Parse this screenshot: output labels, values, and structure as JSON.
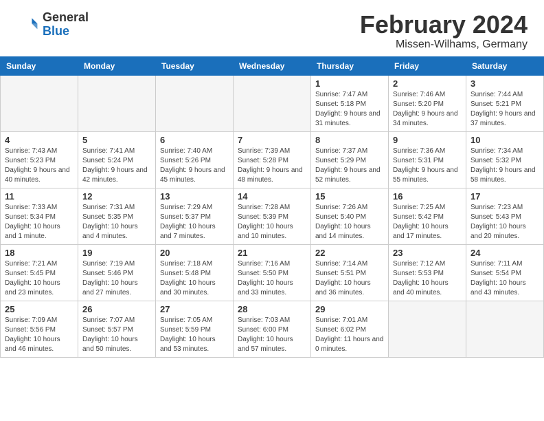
{
  "header": {
    "logo": {
      "general": "General",
      "blue": "Blue"
    },
    "title": "February 2024",
    "subtitle": "Missen-Wilhams, Germany"
  },
  "weekdays": [
    "Sunday",
    "Monday",
    "Tuesday",
    "Wednesday",
    "Thursday",
    "Friday",
    "Saturday"
  ],
  "weeks": [
    [
      {
        "day": "",
        "empty": true
      },
      {
        "day": "",
        "empty": true
      },
      {
        "day": "",
        "empty": true
      },
      {
        "day": "",
        "empty": true
      },
      {
        "day": "1",
        "sunrise": "7:47 AM",
        "sunset": "5:18 PM",
        "daylight": "9 hours and 31 minutes."
      },
      {
        "day": "2",
        "sunrise": "7:46 AM",
        "sunset": "5:20 PM",
        "daylight": "9 hours and 34 minutes."
      },
      {
        "day": "3",
        "sunrise": "7:44 AM",
        "sunset": "5:21 PM",
        "daylight": "9 hours and 37 minutes."
      }
    ],
    [
      {
        "day": "4",
        "sunrise": "7:43 AM",
        "sunset": "5:23 PM",
        "daylight": "9 hours and 40 minutes."
      },
      {
        "day": "5",
        "sunrise": "7:41 AM",
        "sunset": "5:24 PM",
        "daylight": "9 hours and 42 minutes."
      },
      {
        "day": "6",
        "sunrise": "7:40 AM",
        "sunset": "5:26 PM",
        "daylight": "9 hours and 45 minutes."
      },
      {
        "day": "7",
        "sunrise": "7:39 AM",
        "sunset": "5:28 PM",
        "daylight": "9 hours and 48 minutes."
      },
      {
        "day": "8",
        "sunrise": "7:37 AM",
        "sunset": "5:29 PM",
        "daylight": "9 hours and 52 minutes."
      },
      {
        "day": "9",
        "sunrise": "7:36 AM",
        "sunset": "5:31 PM",
        "daylight": "9 hours and 55 minutes."
      },
      {
        "day": "10",
        "sunrise": "7:34 AM",
        "sunset": "5:32 PM",
        "daylight": "9 hours and 58 minutes."
      }
    ],
    [
      {
        "day": "11",
        "sunrise": "7:33 AM",
        "sunset": "5:34 PM",
        "daylight": "10 hours and 1 minute."
      },
      {
        "day": "12",
        "sunrise": "7:31 AM",
        "sunset": "5:35 PM",
        "daylight": "10 hours and 4 minutes."
      },
      {
        "day": "13",
        "sunrise": "7:29 AM",
        "sunset": "5:37 PM",
        "daylight": "10 hours and 7 minutes."
      },
      {
        "day": "14",
        "sunrise": "7:28 AM",
        "sunset": "5:39 PM",
        "daylight": "10 hours and 10 minutes."
      },
      {
        "day": "15",
        "sunrise": "7:26 AM",
        "sunset": "5:40 PM",
        "daylight": "10 hours and 14 minutes."
      },
      {
        "day": "16",
        "sunrise": "7:25 AM",
        "sunset": "5:42 PM",
        "daylight": "10 hours and 17 minutes."
      },
      {
        "day": "17",
        "sunrise": "7:23 AM",
        "sunset": "5:43 PM",
        "daylight": "10 hours and 20 minutes."
      }
    ],
    [
      {
        "day": "18",
        "sunrise": "7:21 AM",
        "sunset": "5:45 PM",
        "daylight": "10 hours and 23 minutes."
      },
      {
        "day": "19",
        "sunrise": "7:19 AM",
        "sunset": "5:46 PM",
        "daylight": "10 hours and 27 minutes."
      },
      {
        "day": "20",
        "sunrise": "7:18 AM",
        "sunset": "5:48 PM",
        "daylight": "10 hours and 30 minutes."
      },
      {
        "day": "21",
        "sunrise": "7:16 AM",
        "sunset": "5:50 PM",
        "daylight": "10 hours and 33 minutes."
      },
      {
        "day": "22",
        "sunrise": "7:14 AM",
        "sunset": "5:51 PM",
        "daylight": "10 hours and 36 minutes."
      },
      {
        "day": "23",
        "sunrise": "7:12 AM",
        "sunset": "5:53 PM",
        "daylight": "10 hours and 40 minutes."
      },
      {
        "day": "24",
        "sunrise": "7:11 AM",
        "sunset": "5:54 PM",
        "daylight": "10 hours and 43 minutes."
      }
    ],
    [
      {
        "day": "25",
        "sunrise": "7:09 AM",
        "sunset": "5:56 PM",
        "daylight": "10 hours and 46 minutes."
      },
      {
        "day": "26",
        "sunrise": "7:07 AM",
        "sunset": "5:57 PM",
        "daylight": "10 hours and 50 minutes."
      },
      {
        "day": "27",
        "sunrise": "7:05 AM",
        "sunset": "5:59 PM",
        "daylight": "10 hours and 53 minutes."
      },
      {
        "day": "28",
        "sunrise": "7:03 AM",
        "sunset": "6:00 PM",
        "daylight": "10 hours and 57 minutes."
      },
      {
        "day": "29",
        "sunrise": "7:01 AM",
        "sunset": "6:02 PM",
        "daylight": "11 hours and 0 minutes."
      },
      {
        "day": "",
        "empty": true
      },
      {
        "day": "",
        "empty": true
      }
    ]
  ],
  "labels": {
    "sunrise": "Sunrise:",
    "sunset": "Sunset:",
    "daylight": "Daylight:"
  }
}
